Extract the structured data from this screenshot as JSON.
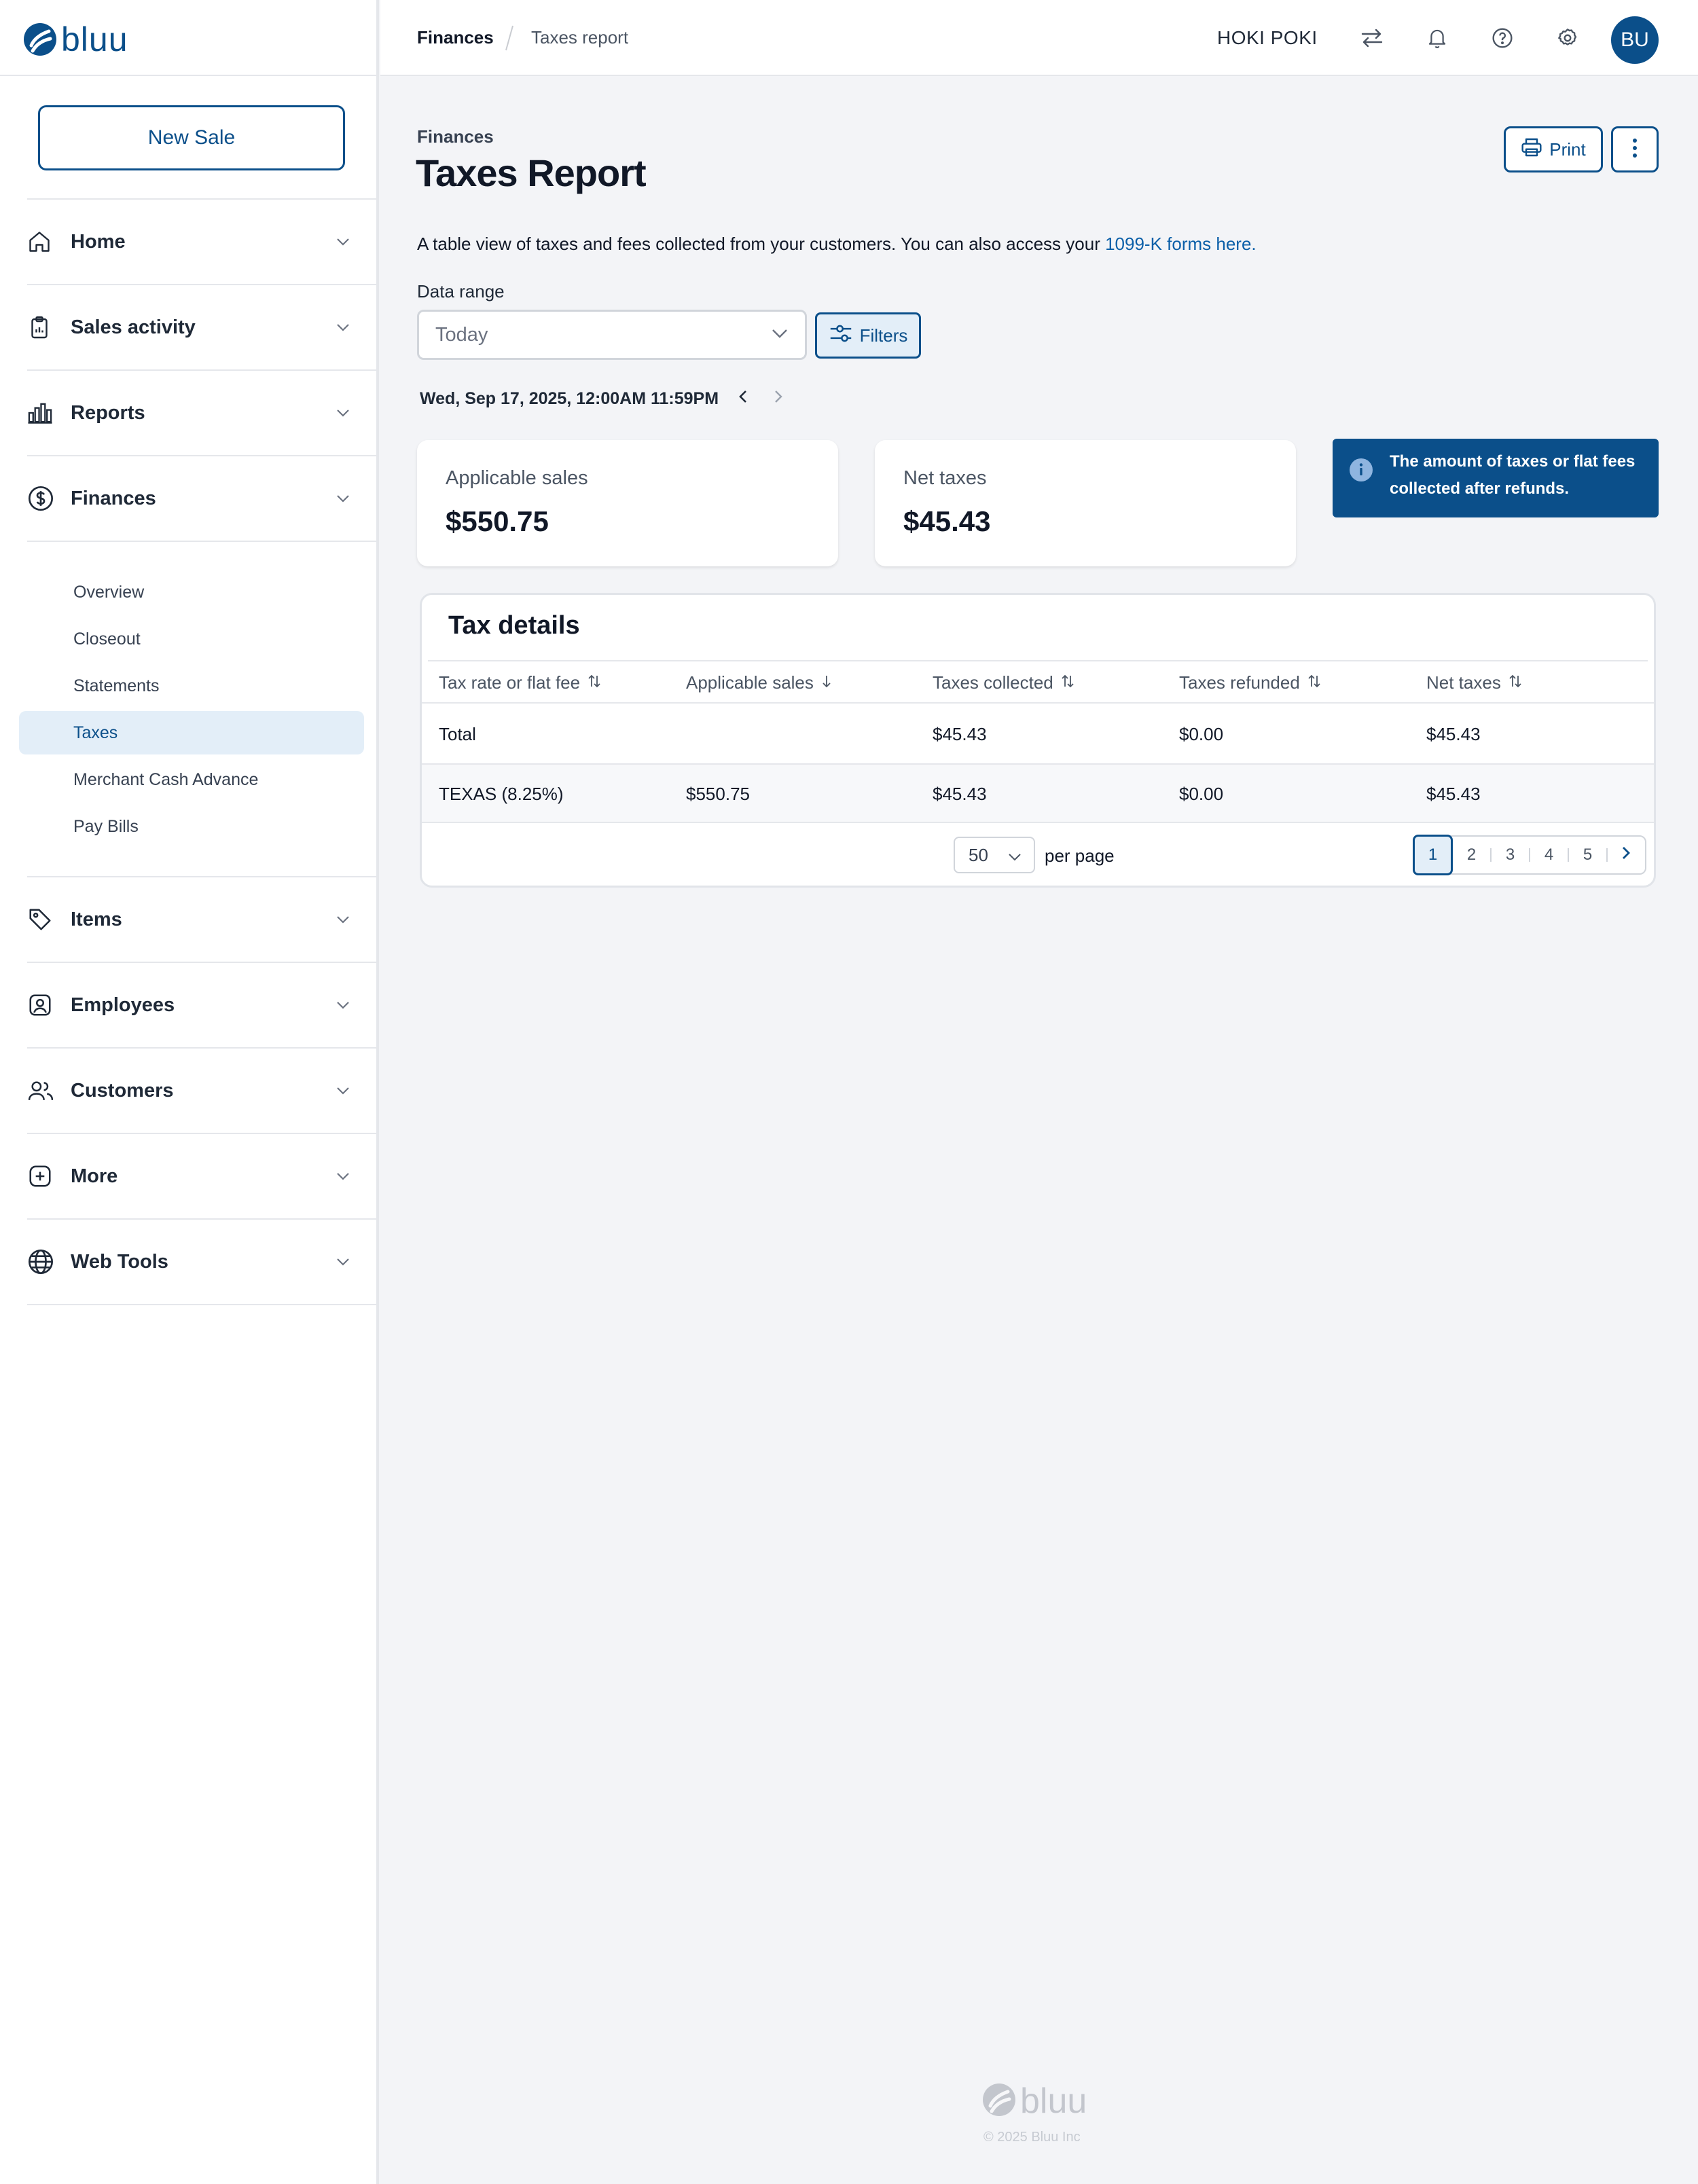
{
  "brand": {
    "name": "bluu",
    "accent": "#0b4f8a"
  },
  "sidebar": {
    "new_sale_label": "New Sale",
    "items": [
      {
        "label": "Home",
        "icon": "home-icon"
      },
      {
        "label": "Sales activity",
        "icon": "clipboard-icon"
      },
      {
        "label": "Reports",
        "icon": "bar-chart-icon"
      },
      {
        "label": "Finances",
        "icon": "dollar-circle-icon"
      },
      {
        "label": "Items",
        "icon": "tag-icon"
      },
      {
        "label": "Employees",
        "icon": "id-badge-icon"
      },
      {
        "label": "Customers",
        "icon": "users-icon"
      },
      {
        "label": "More",
        "icon": "plus-square-icon"
      },
      {
        "label": "Web Tools",
        "icon": "globe-icon"
      }
    ],
    "finances_subitems": [
      "Overview",
      "Closeout",
      "Statements",
      "Taxes",
      "Merchant Cash Advance",
      "Pay Bills"
    ],
    "active_subitem": "Taxes"
  },
  "header": {
    "breadcrumb": [
      "Finances",
      "Taxes report"
    ],
    "store_name": "HOKI POKI",
    "avatar_initials": "BU",
    "icons": [
      "transfer-icon",
      "bell-icon",
      "help-icon",
      "settings-icon"
    ]
  },
  "page": {
    "section": "Finances",
    "title": "Taxes Report",
    "print_label": "Print",
    "description_prefix": "A table view of taxes and fees collected from your customers. You can also access your ",
    "description_link": "1099-K forms here.",
    "range_label": "Data range",
    "range_value": "Today",
    "filters_label": "Filters",
    "date_text": "Wed, Sep 17, 2025, 12:00AM 11:59PM"
  },
  "summary": {
    "applicable_sales_label": "Applicable sales",
    "applicable_sales_value": "$550.75",
    "net_taxes_label": "Net taxes",
    "net_taxes_value": "$45.43",
    "info_text": "The amount of taxes or flat fees collected after refunds."
  },
  "tax_details": {
    "title": "Tax details",
    "columns": [
      "Tax rate or flat fee",
      "Applicable sales",
      "Taxes collected",
      "Taxes refunded",
      "Net taxes"
    ],
    "rows": [
      [
        "Total",
        "",
        "$45.43",
        "$0.00",
        "$45.43"
      ],
      [
        "TEXAS (8.25%)",
        "$550.75",
        "$45.43",
        "$0.00",
        "$45.43"
      ]
    ],
    "per_page_value": "50",
    "per_page_label": "per page",
    "pages": [
      "1",
      "2",
      "3",
      "4",
      "5"
    ],
    "current_page": "1"
  },
  "footer": {
    "brand": "bluu",
    "copyright": "© 2025 Bluu Inc"
  }
}
